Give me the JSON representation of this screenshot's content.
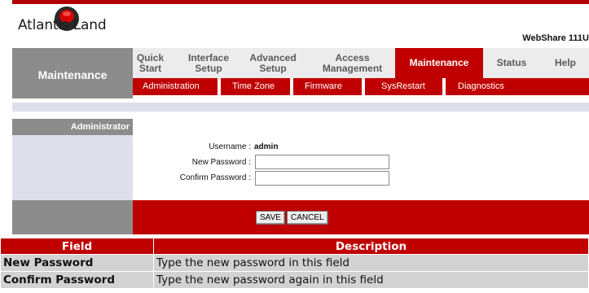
{
  "brand": {
    "logo_text": "Atlantis Land",
    "product": "WebShare 111U"
  },
  "section_title": "Maintenance",
  "nav": {
    "tabs": [
      {
        "label": "Quick\nStart"
      },
      {
        "label": "Interface\nSetup"
      },
      {
        "label": "Advanced\nSetup"
      },
      {
        "label": "Access\nManagement"
      },
      {
        "label": "Maintenance",
        "active": true
      },
      {
        "label": "Status"
      },
      {
        "label": "Help"
      }
    ],
    "subtabs": [
      {
        "label": "Administration"
      },
      {
        "label": "Time Zone"
      },
      {
        "label": "Firmware"
      },
      {
        "label": "SysRestart"
      },
      {
        "label": "Diagnostics"
      }
    ]
  },
  "admin": {
    "header": "Administrator",
    "username_label": "Username :",
    "username_value": "admin",
    "new_password_label": "New Password :",
    "confirm_password_label": "Confirm Password :",
    "new_password_value": "",
    "confirm_password_value": ""
  },
  "buttons": {
    "save": "SAVE",
    "cancel": "CANCEL"
  },
  "desc_table": {
    "headers": [
      "Field",
      "Description"
    ],
    "rows": [
      [
        "New Password",
        "Type the new password in this field"
      ],
      [
        "Confirm Password",
        "Type the new password again in this field"
      ]
    ]
  },
  "colors": {
    "brand_red": "#c00000",
    "menu_gray": "#8c8c8c",
    "nav_light": "#ececec",
    "panel_lavender": "#dde0ea"
  }
}
